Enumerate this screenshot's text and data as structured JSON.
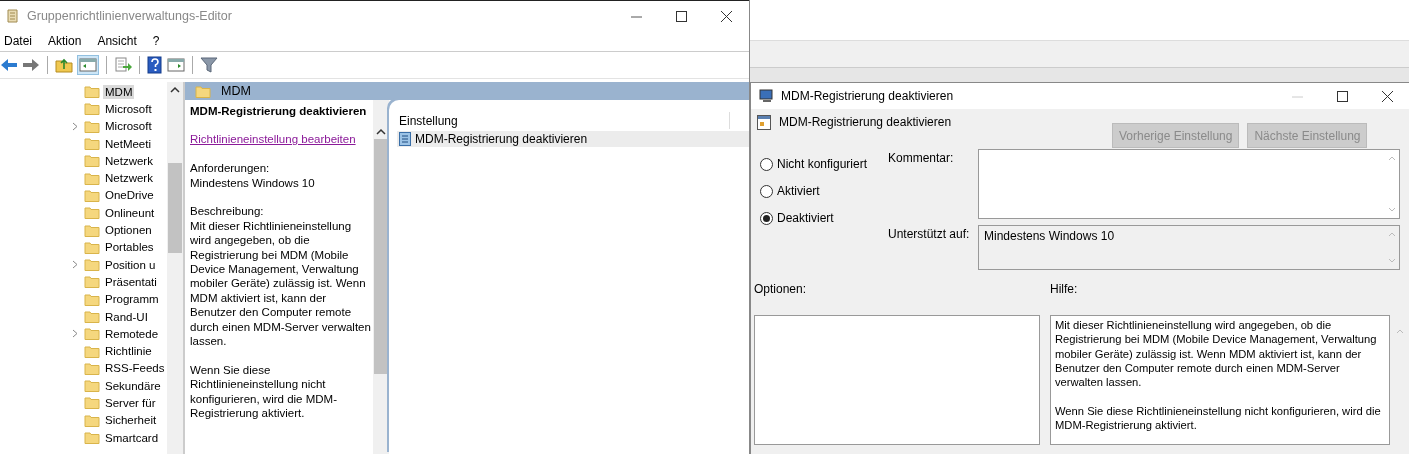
{
  "main_window": {
    "title": "Gruppenrichtlinienverwaltungs-Editor",
    "menu": [
      "Datei",
      "Aktion",
      "Ansicht",
      "?"
    ],
    "tree": [
      {
        "label": "MDM",
        "expandable": false,
        "selected": true
      },
      {
        "label": "Microsoft",
        "expandable": false,
        "selected": false
      },
      {
        "label": "Microsoft",
        "expandable": true,
        "selected": false
      },
      {
        "label": "NetMeeti",
        "expandable": false,
        "selected": false
      },
      {
        "label": "Netzwerk",
        "expandable": false,
        "selected": false
      },
      {
        "label": "Netzwerk",
        "expandable": false,
        "selected": false
      },
      {
        "label": "OneDrive",
        "expandable": false,
        "selected": false
      },
      {
        "label": "Onlineunt",
        "expandable": false,
        "selected": false
      },
      {
        "label": "Optionen",
        "expandable": false,
        "selected": false
      },
      {
        "label": "Portables",
        "expandable": false,
        "selected": false
      },
      {
        "label": "Position u",
        "expandable": true,
        "selected": false
      },
      {
        "label": "Präsentati",
        "expandable": false,
        "selected": false
      },
      {
        "label": "Programm",
        "expandable": false,
        "selected": false
      },
      {
        "label": "Rand-UI",
        "expandable": false,
        "selected": false
      },
      {
        "label": "Remotede",
        "expandable": true,
        "selected": false
      },
      {
        "label": "Richtlinie",
        "expandable": false,
        "selected": false
      },
      {
        "label": "RSS-Feeds",
        "expandable": false,
        "selected": false
      },
      {
        "label": "Sekundäre",
        "expandable": false,
        "selected": false
      },
      {
        "label": "Server für",
        "expandable": false,
        "selected": false
      },
      {
        "label": "Sicherheit",
        "expandable": false,
        "selected": false
      },
      {
        "label": "Smartcard",
        "expandable": false,
        "selected": false
      }
    ],
    "details": {
      "header": "MDM",
      "policy_title": "MDM-Registrierung deaktivieren",
      "edit_link": "Richtlinieneinstellung bearbeiten",
      "requirements_label": "Anforderungen:",
      "requirements": "Mindestens Windows 10",
      "description_label": "Beschreibung:",
      "description": [
        "Mit dieser Richtlinieneinstellung wird angegeben, ob die Registrierung bei MDM (Mobile Device Management, Verwaltung mobiler Geräte) zulässig ist. Wenn MDM aktiviert ist, kann der Benutzer den Computer remote durch einen MDM-Server verwalten lassen.",
        "Wenn Sie diese Richtlinieneinstellung nicht konfigurieren, wird die MDM-Registrierung aktiviert."
      ]
    },
    "list": {
      "columns": [
        "Einstellung"
      ],
      "rows": [
        {
          "label": "MDM-Registrierung deaktivieren",
          "selected": true
        }
      ]
    }
  },
  "dialog": {
    "title": "MDM-Registrierung deaktivieren",
    "policy_name": "MDM-Registrierung deaktivieren",
    "buttons": [
      {
        "label": "Vorherige Einstellung",
        "disabled": true
      },
      {
        "label": "Nächste Einstellung",
        "disabled": true
      }
    ],
    "states": [
      {
        "label": "Nicht konfiguriert",
        "selected": false
      },
      {
        "label": "Aktiviert",
        "selected": false
      },
      {
        "label": "Deaktiviert",
        "selected": true
      }
    ],
    "comment_label": "Kommentar:",
    "supported_label": "Unterstützt auf:",
    "supported": "Mindestens Windows 10",
    "options_label": "Optionen:",
    "help_label": "Hilfe:",
    "help": [
      "Mit dieser Richtlinieneinstellung wird angegeben, ob die Registrierung bei MDM (Mobile Device Management, Verwaltung mobiler Geräte) zulässig ist. Wenn MDM aktiviert ist, kann der Benutzer den Computer remote durch einen MDM-Server verwalten lassen.",
      "Wenn Sie diese Richtlinieneinstellung nicht konfigurieren, wird die MDM-Registrierung aktiviert."
    ]
  }
}
